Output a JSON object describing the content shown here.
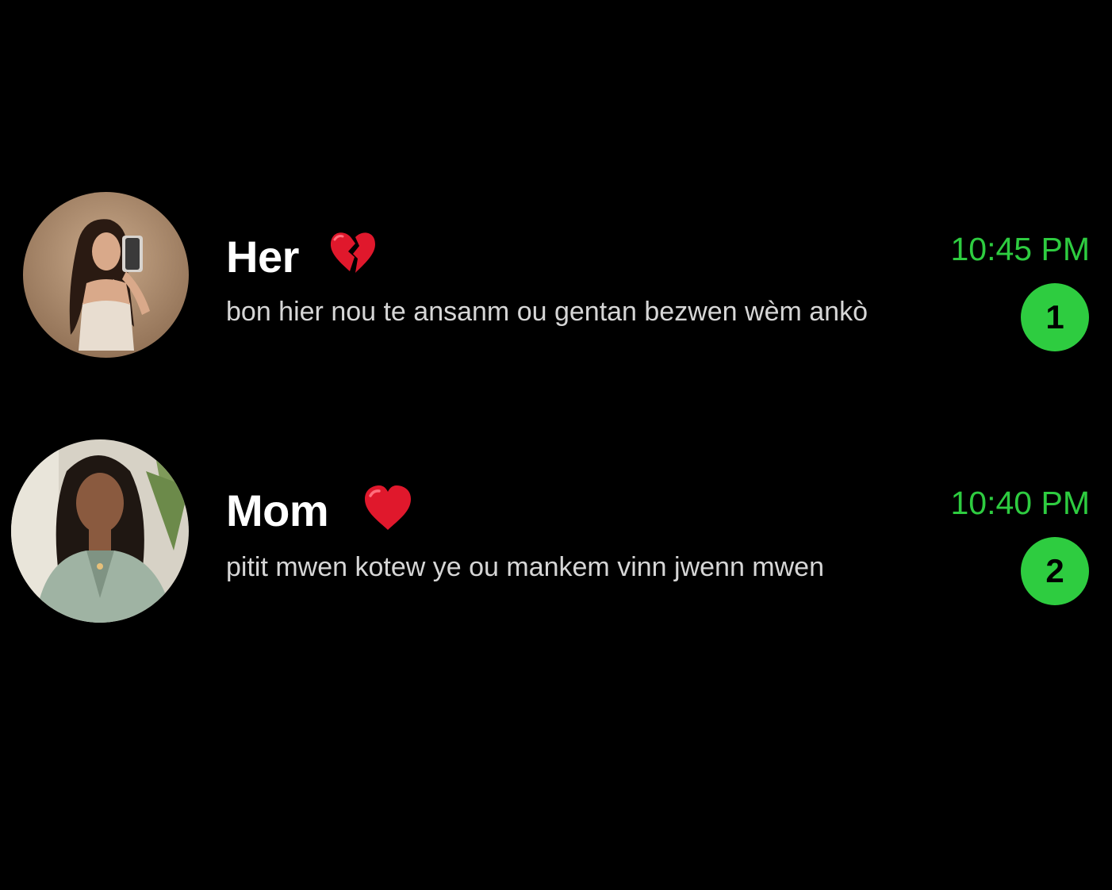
{
  "colors": {
    "background": "#000000",
    "name": "#ffffff",
    "preview": "#d6d6d6",
    "accent": "#2ecc40",
    "badge_text": "#000000"
  },
  "chats": [
    {
      "name": "Her",
      "emoji": "broken-heart-icon",
      "preview": "bon hier nou te ansanm ou gentan bezwen wèm ankò",
      "time": "10:45 PM",
      "unread": "1",
      "avatar": "profile-photo-her"
    },
    {
      "name": "Mom",
      "emoji": "red-heart-icon",
      "preview": "pitit mwen kotew ye ou mankem vinn jwenn mwen",
      "time": "10:40 PM",
      "unread": "2",
      "avatar": "profile-photo-mom"
    }
  ]
}
